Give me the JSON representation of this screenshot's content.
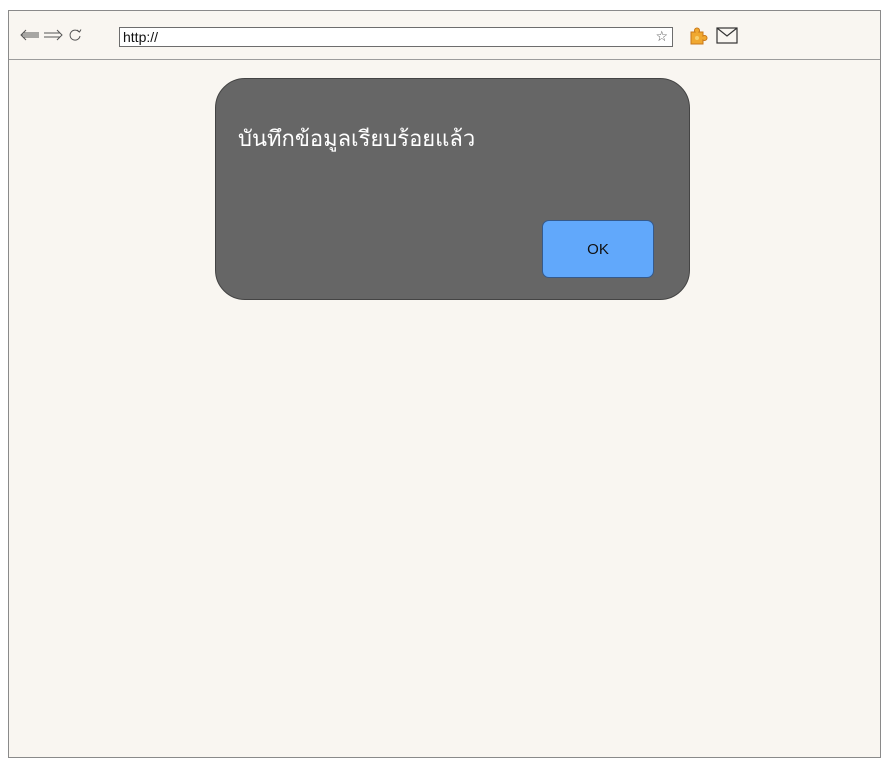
{
  "browser": {
    "address": "http://",
    "icons": {
      "back": "back-arrow-icon",
      "forward": "forward-arrow-icon",
      "reload": "reload-icon",
      "bookmark": "star-icon",
      "extension": "puzzle-extension-icon",
      "mail": "mail-icon"
    }
  },
  "dialog": {
    "message": "บันทึกข้อมูลเรียบร้อยแล้ว",
    "ok_label": "OK",
    "background": "#666666",
    "button_color": "#61a8fb"
  },
  "colors": {
    "page_background": "#f9f6f1",
    "extension_icon": "#f0a830"
  }
}
